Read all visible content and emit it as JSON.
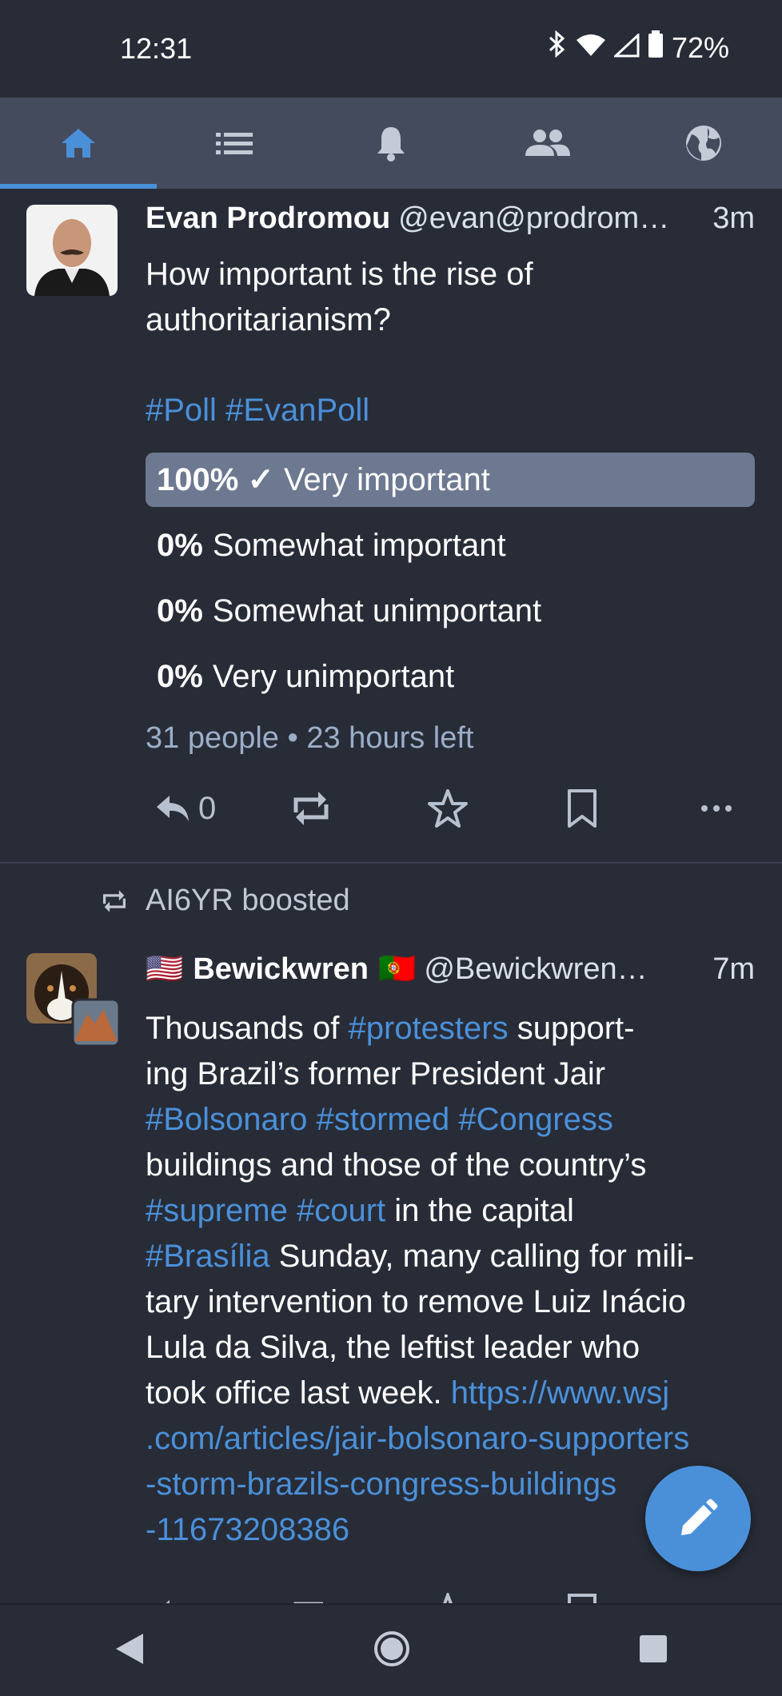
{
  "status_bar": {
    "time": "12:31",
    "battery": "72%"
  },
  "tabs": [
    {
      "name": "home",
      "icon": "home-icon",
      "active": true
    },
    {
      "name": "lists",
      "icon": "list-icon"
    },
    {
      "name": "notifications",
      "icon": "bell-icon"
    },
    {
      "name": "community",
      "icon": "people-icon"
    },
    {
      "name": "federated",
      "icon": "globe-icon"
    }
  ],
  "post1": {
    "display_name": "Evan Prodromou",
    "acct": "@evan@prodrom…",
    "time": "3m",
    "text": "How important is the rise of authoritarianism?",
    "hashtags": [
      "#Poll",
      "#EvanPoll"
    ],
    "poll": {
      "options": [
        {
          "percent": "100% ✓",
          "label": "Very important",
          "winner": true
        },
        {
          "percent": "0%",
          "label": "Somewhat important"
        },
        {
          "percent": "0%",
          "label": "Somewhat unimportant"
        },
        {
          "percent": "0%",
          "label": "Very unimportant"
        }
      ],
      "footer": "31 people • 23 hours left"
    },
    "reply_count": "0"
  },
  "boost": {
    "text": "AI6YR boosted"
  },
  "post2": {
    "flag_left": "🇺🇸",
    "display_name": "Bewickwren",
    "flag_right": "🇵🇹",
    "acct": "@Bewickwren…",
    "time": "7m",
    "lines": [
      [
        [
          "t",
          "Thousands of "
        ],
        [
          "h",
          "#protesters"
        ],
        [
          "t",
          " support-"
        ]
      ],
      [
        [
          "t",
          "ing Brazil’s former President Jair"
        ]
      ],
      [
        [
          "h",
          "#Bolsonaro"
        ],
        [
          "t",
          " "
        ],
        [
          "h",
          "#stormed"
        ],
        [
          "t",
          " "
        ],
        [
          "h",
          "#Congress"
        ]
      ],
      [
        [
          "t",
          "buildings and those of the country’s"
        ]
      ],
      [
        [
          "h",
          "#supreme"
        ],
        [
          "t",
          " "
        ],
        [
          "h",
          "#court"
        ],
        [
          "t",
          " in the capital"
        ]
      ],
      [
        [
          "h",
          "#Brasília"
        ],
        [
          "t",
          " Sunday, many calling for mili-"
        ]
      ],
      [
        [
          "t",
          "tary intervention to remove Luiz Inácio"
        ]
      ],
      [
        [
          "t",
          "Lula da Silva, the leftist leader who"
        ]
      ],
      [
        [
          "t",
          "took office last week. "
        ],
        [
          "h",
          "https://www.wsj"
        ]
      ],
      [
        [
          "h",
          ".com/articles/jair-bolsonaro-supporters"
        ]
      ],
      [
        [
          "h",
          "-storm-brazils-congress-buildings"
        ]
      ],
      [
        [
          "h",
          "-11673208386"
        ]
      ]
    ]
  },
  "colors": {
    "accent": "#4a90d9",
    "background": "#282c37",
    "tabbar": "#444b5d"
  }
}
